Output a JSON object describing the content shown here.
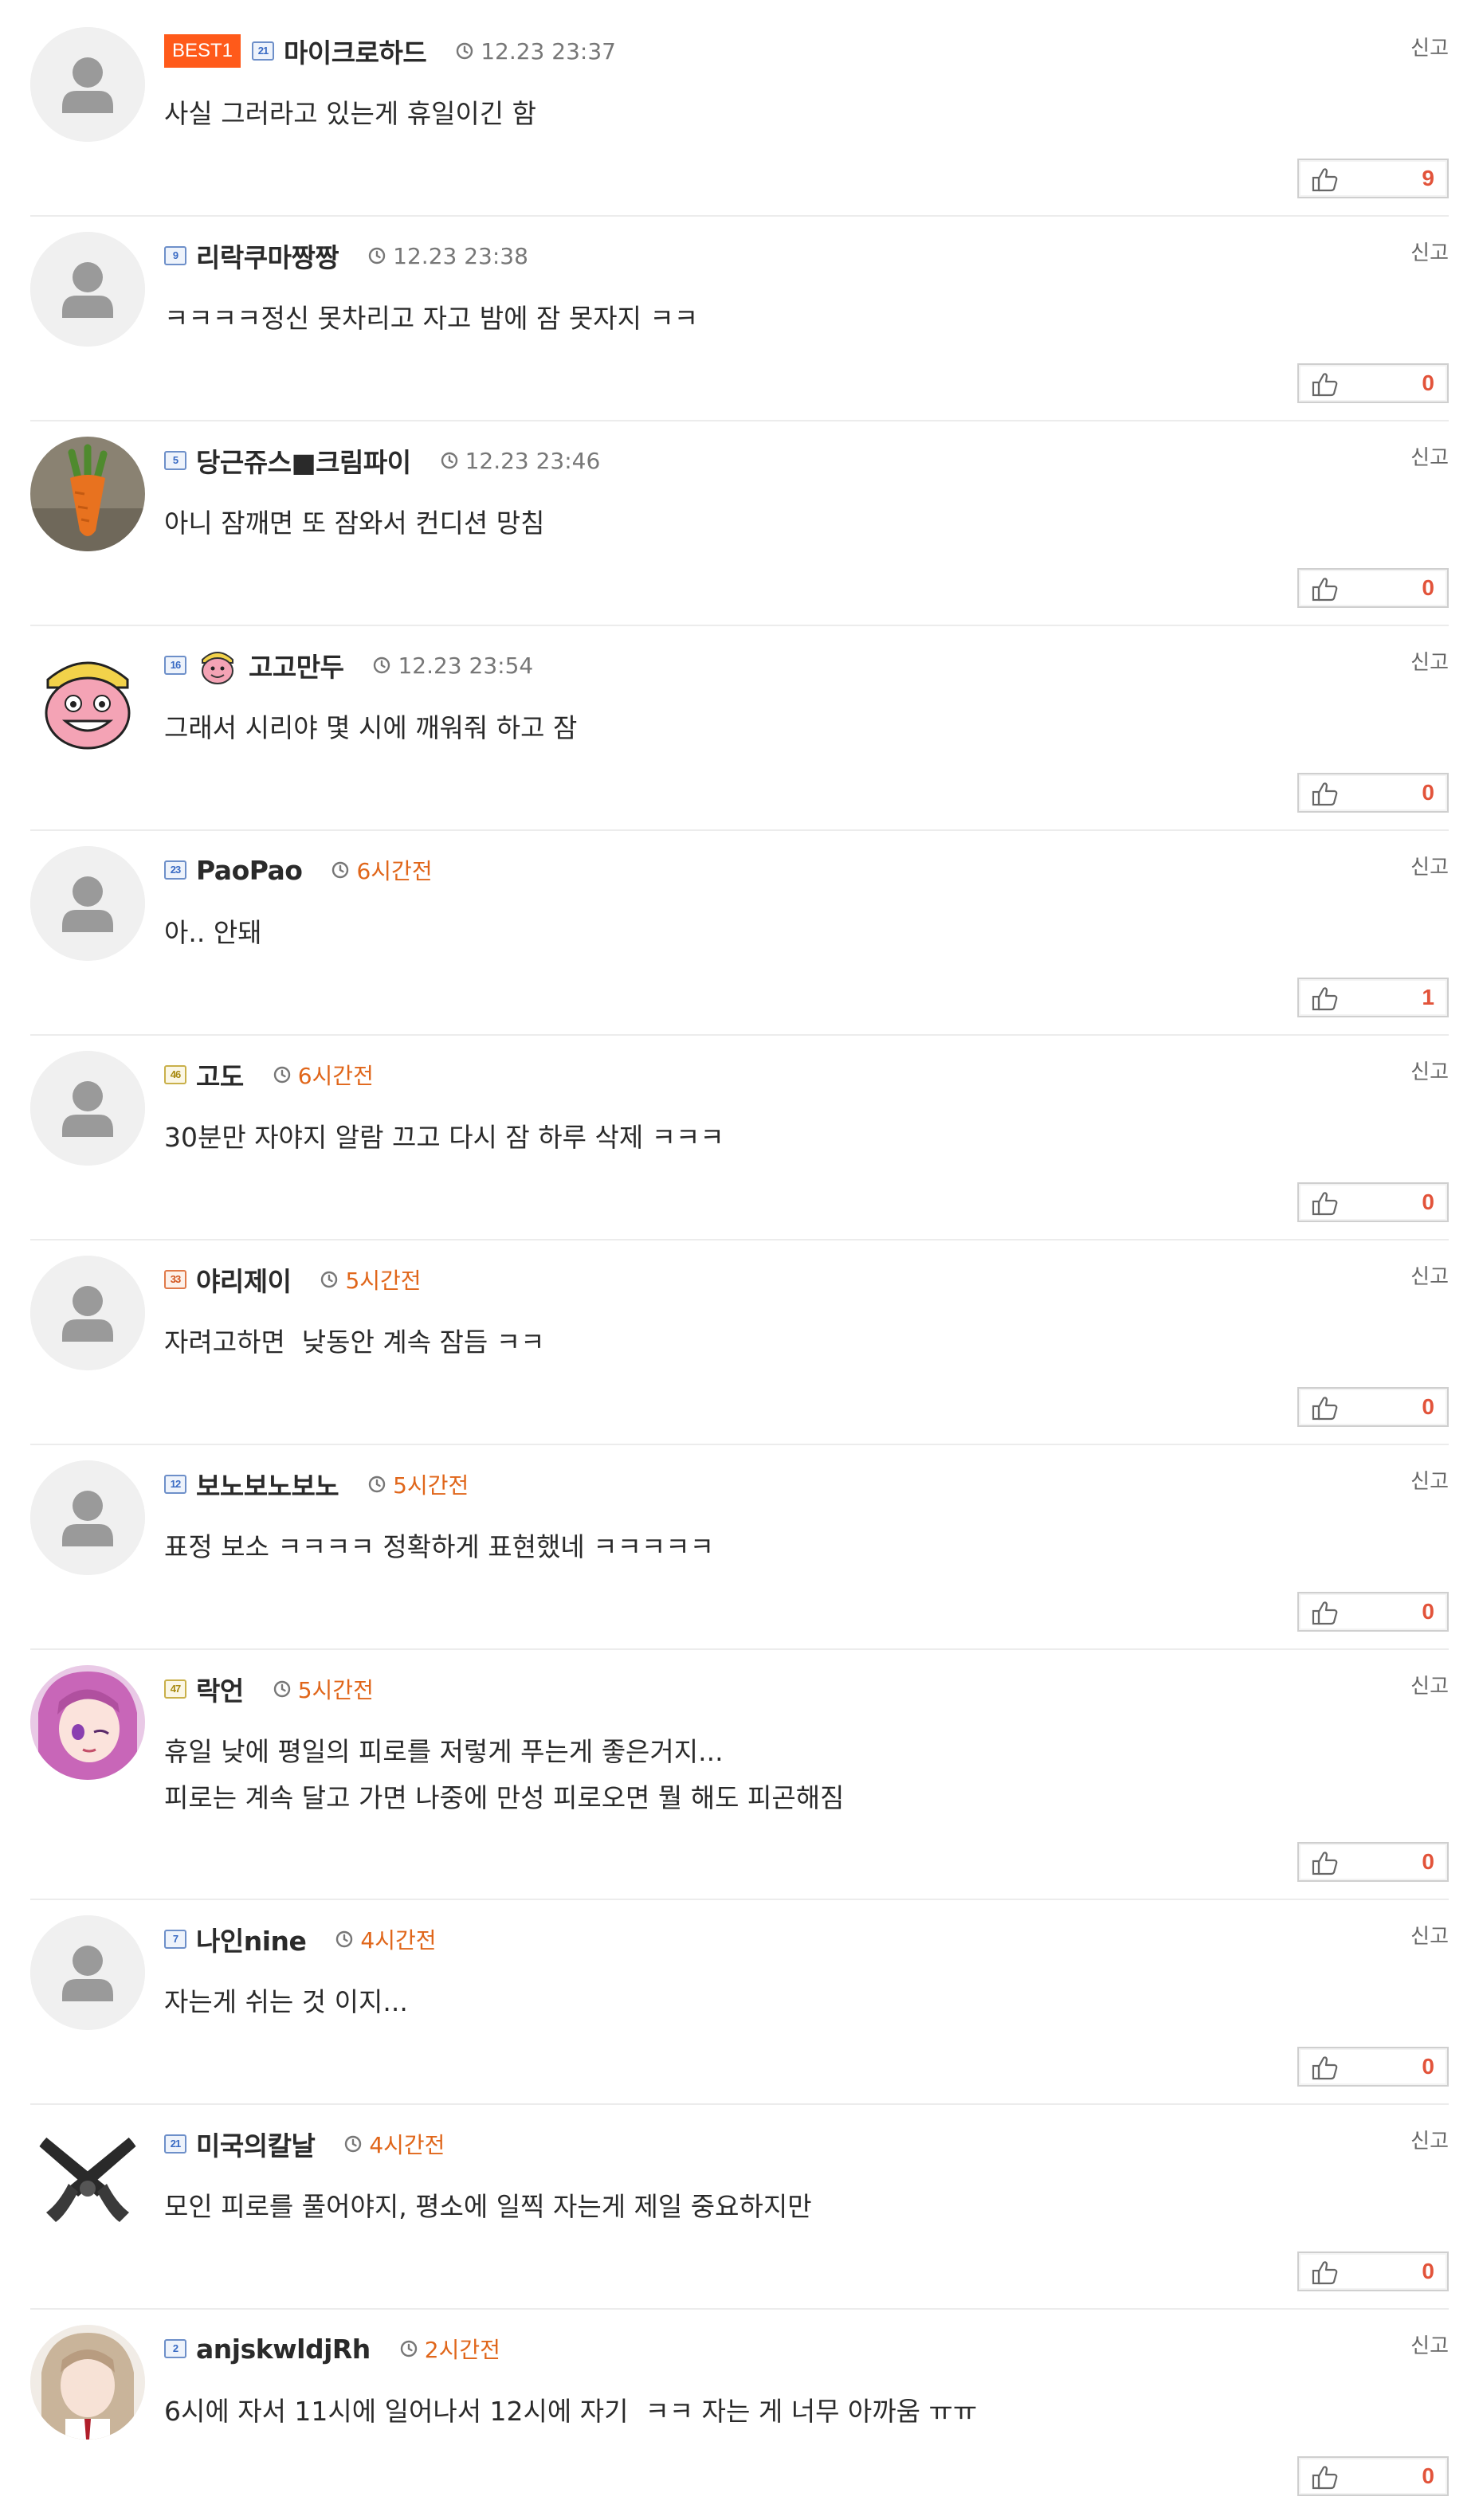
{
  "report_label": "신고",
  "best_label": "BEST1",
  "comments": [
    {
      "nick": "마이크로하드",
      "level": "21",
      "time": "12.23 23:37",
      "text": "사실 그러라고 있는게 휴일이긴 함",
      "likes": "9"
    },
    {
      "nick": "리락쿠마짱짱",
      "level": "9",
      "time": "12.23 23:38",
      "text": "ㅋㅋㅋㅋ정신 못차리고 자고 밤에 잠 못자지 ㅋㅋ",
      "likes": "0"
    },
    {
      "nick": "당근쥬스■크림파이",
      "level": "5",
      "time": "12.23 23:46",
      "text": "아니 잠깨면 또 잠와서 컨디션 망침",
      "likes": "0"
    },
    {
      "nick": "고고만두",
      "level": "16",
      "time": "12.23 23:54",
      "text": "그래서 시리야 몇 시에 깨워줘 하고 잠",
      "likes": "0"
    },
    {
      "nick": "PaoPao",
      "level": "23",
      "time": "6시간전",
      "text": "아.. 안돼",
      "likes": "1"
    },
    {
      "nick": "고도",
      "level": "46",
      "time": "6시간전",
      "text": "30분만 자야지 알람 끄고 다시 잠 하루 삭제 ㅋㅋㅋ",
      "likes": "0"
    },
    {
      "nick": "야리제이",
      "level": "33",
      "time": "5시간전",
      "text": "자려고하면  낮동안 계속 잠듬 ㅋㅋ",
      "likes": "0"
    },
    {
      "nick": "보노보노보노",
      "level": "12",
      "time": "5시간전",
      "text": "표정 보소 ㅋㅋㅋㅋ 정확하게 표현했네 ㅋㅋㅋㅋㅋ",
      "likes": "0"
    },
    {
      "nick": "락언",
      "level": "47",
      "time": "5시간전",
      "text_lines": [
        "휴일 낮에 평일의 피로를 저렇게 푸는게 좋은거지...",
        "피로는 계속 달고 가면 나중에 만성 피로오면 뭘 해도 피곤해짐"
      ],
      "likes": "0"
    },
    {
      "nick": "나인nine",
      "level": "7",
      "time": "4시간전",
      "text": "자는게 쉬는 것 이지...",
      "likes": "0"
    },
    {
      "nick": "미국의칼날",
      "level": "21",
      "time": "4시간전",
      "text": "모인 피로를 풀어야지, 평소에 일찍 자는게 제일 중요하지만",
      "likes": "0"
    },
    {
      "nick": "anjskwldjRh",
      "level": "2",
      "time": "2시간전",
      "text": "6시에 자서 11시에 일어나서 12시에 자기  ㅋㅋ 자는 게 너무 아까움 ㅠㅠ",
      "likes": "0"
    }
  ]
}
